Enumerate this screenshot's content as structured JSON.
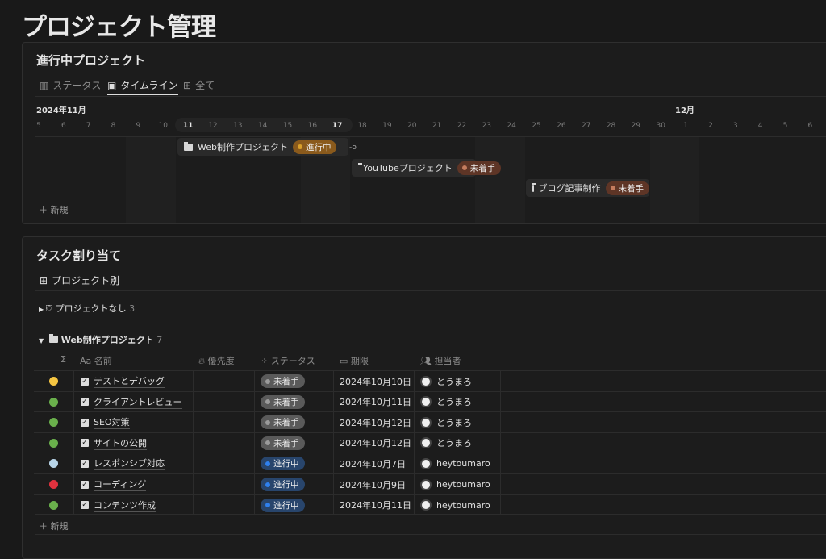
{
  "page": {
    "title": "プロジェクト管理"
  },
  "projects": {
    "title": "進行中プロジェクト",
    "tabs": [
      {
        "label": "ステータス",
        "icon": "board-icon"
      },
      {
        "label": "タイムライン",
        "icon": "timeline-icon",
        "active": true
      },
      {
        "label": "全て",
        "icon": "table-icon"
      }
    ],
    "timeline": {
      "month_nov": "2024年11月",
      "month_dec": "12月",
      "days": [
        "5",
        "6",
        "7",
        "8",
        "9",
        "10",
        "11",
        "12",
        "13",
        "14",
        "15",
        "16",
        "17",
        "18",
        "19",
        "20",
        "21",
        "22",
        "23",
        "24",
        "25",
        "26",
        "27",
        "28",
        "29",
        "30",
        "1",
        "2",
        "3",
        "4",
        "5",
        "6"
      ],
      "items": [
        {
          "name": "Web制作プロジェクト",
          "status": "進行中",
          "status_color": "#8a5a1c",
          "dot_color": "#d9a02b"
        },
        {
          "name": "YouTubeプロジェクト",
          "status": "未着手",
          "status_color": "#5e3526",
          "dot_color": "#c47c5e"
        },
        {
          "name": "ブログ記事制作",
          "status": "未着手",
          "status_color": "#5e3526",
          "dot_color": "#c47c5e"
        }
      ],
      "new_label": "新規"
    }
  },
  "tasks": {
    "title": "タスク割り当て",
    "view_label": "プロジェクト別",
    "groups": [
      {
        "name": "プロジェクトなし",
        "count": "3",
        "collapsed": true
      },
      {
        "name": "Web制作プロジェクト",
        "count": "7",
        "collapsed": false
      }
    ],
    "columns": {
      "sigma": "Σ",
      "name": "名前",
      "priority": "優先度",
      "status": "ステータス",
      "due": "期限",
      "assignee": "担当者"
    },
    "rows": [
      {
        "priority_color": "#f5c542",
        "name": "テストとデバッグ",
        "status": "未着手",
        "due": "2024年10月10日",
        "assignee": "とうまろ"
      },
      {
        "priority_color": "#6ab04c",
        "name": "クライアントレビュー",
        "status": "未着手",
        "due": "2024年10月11日",
        "assignee": "とうまろ"
      },
      {
        "priority_color": "#6ab04c",
        "name": "SEO対策",
        "status": "未着手",
        "due": "2024年10月12日",
        "assignee": "とうまろ"
      },
      {
        "priority_color": "#6ab04c",
        "name": "サイトの公開",
        "status": "未着手",
        "due": "2024年10月12日",
        "assignee": "とうまろ"
      },
      {
        "priority_color": "#b8d4e8",
        "name": "レスポンシブ対応",
        "status": "進行中",
        "due": "2024年10月7日",
        "assignee": "heytoumaro"
      },
      {
        "priority_color": "#e0323e",
        "name": "コーディング",
        "status": "進行中",
        "due": "2024年10月9日",
        "assignee": "heytoumaro"
      },
      {
        "priority_color": "#6ab04c",
        "name": "コンテンツ作成",
        "status": "進行中",
        "due": "2024年10月11日",
        "assignee": "heytoumaro"
      }
    ],
    "status_colors": {
      "未着手": "#5a5a5a",
      "進行中": "#28456c"
    },
    "status_dots": {
      "未着手": "#9b9b9b",
      "進行中": "#2f80ed"
    },
    "new_label": "新規"
  }
}
